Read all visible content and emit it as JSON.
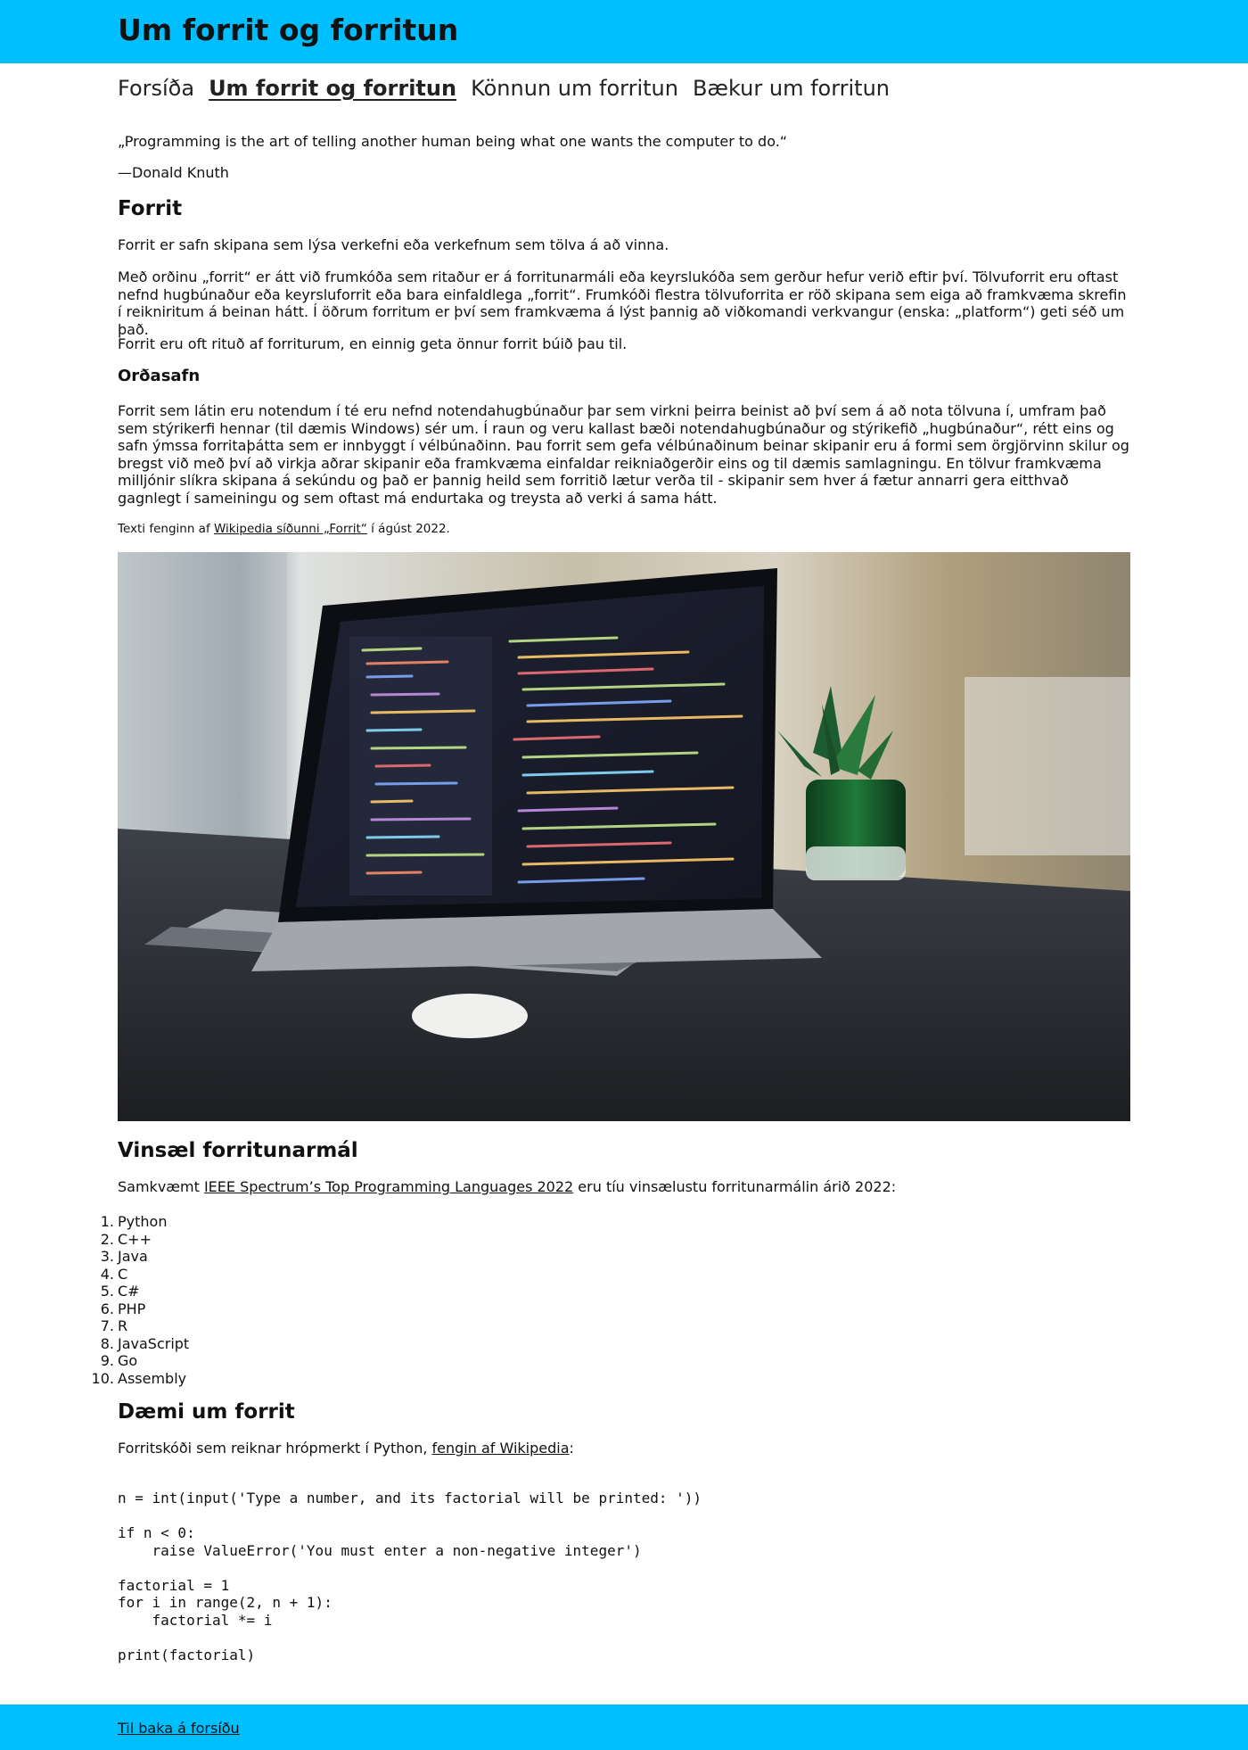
{
  "header": {
    "title": "Um forrit og forritun"
  },
  "nav": {
    "items": [
      {
        "label": "Forsíða",
        "active": false
      },
      {
        "label": "Um forrit og forritun",
        "active": true
      },
      {
        "label": "Könnun um forritun",
        "active": false
      },
      {
        "label": "Bækur um forritun",
        "active": false
      }
    ]
  },
  "quote": {
    "text": "„Programming is the art of telling another human being what one wants the computer to do.“",
    "author": "—Donald Knuth"
  },
  "section_forrit": {
    "heading": "Forrit",
    "p1": "Forrit er safn skipana sem lýsa verkefni eða verkefnum sem tölva á að vinna.",
    "p2": "Með orðinu „forrit“ er átt við frumkóða sem ritaður er á forritunarmáli eða keyrslukóða sem gerður hefur verið eftir því. Tölvuforrit eru oftast nefnd hugbúnaður eða keyrsluforrit eða bara einfaldlega „forrit“. Frumkóði flestra tölvuforrita er röð skipana sem eiga að framkvæma skrefin í reikniritum á beinan hátt. Í öðrum forritum er því sem framkvæma á lýst þannig að viðkomandi verkvangur (enska: „platform“) geti séð um það.",
    "p3": "Forrit eru oft rituð af forriturum, en einnig geta önnur forrit búið þau til."
  },
  "section_ordasafn": {
    "heading": "Orðasafn",
    "p1": "Forrit sem látin eru notendum í té eru nefnd notendahugbúnaður þar sem virkni þeirra beinist að því sem á að nota tölvuna í, umfram það sem stýrikerfi hennar (til dæmis Windows) sér um. Í raun og veru kallast bæði notendahugbúnaður og stýrikefið „hugbúnaður“, rétt eins og safn ýmssa forritaþátta sem er innbyggt í vélbúnaðinn. Þau forrit sem gefa vélbúnaðinum beinar skipanir eru á formi sem örgjörvinn skilur og bregst við með því að virkja aðrar skipanir eða framkvæma einfaldar reikniaðgerðir eins og til dæmis samlagningu. En tölvur framkvæma milljónir slíkra skipana á sekúndu og það er þannig heild sem forritið lætur verða til - skipanir sem hver á fætur annarri gera eitthvað gagnlegt í sameiningu og sem oftast má endurtaka og treysta að verki á sama hátt."
  },
  "attribution": {
    "prefix": "Texti fenginn af ",
    "link_text": "Wikipedia síðunni „Forrit“",
    "suffix": " í ágúst 2022."
  },
  "hero_image": {
    "alt": "laptop with code and a plant"
  },
  "section_langs": {
    "heading": "Vinsæl forritunarmál",
    "intro_prefix": "Samkvæmt ",
    "intro_link": "IEEE Spectrum’s Top Programming Languages 2022",
    "intro_suffix": " eru tíu vinsælustu forritunarmálin árið 2022:",
    "items": [
      "Python",
      "C++",
      "Java",
      "C",
      "C#",
      "PHP",
      "R",
      "JavaScript",
      "Go",
      "Assembly"
    ],
    "numbers": [
      "1.",
      "2.",
      "3.",
      "4.",
      "5.",
      "6.",
      "7.",
      "8.",
      "9.",
      "10."
    ]
  },
  "section_example": {
    "heading": "Dæmi um forrit",
    "intro_prefix": "Forritskóði sem reiknar hrópmerkt í Python, ",
    "intro_link": "fengin af Wikipedia",
    "intro_suffix": ":",
    "code": "n = int(input('Type a number, and its factorial will be printed: '))\n\nif n < 0:\n    raise ValueError('You must enter a non-negative integer')\n\nfactorial = 1\nfor i in range(2, n + 1):\n    factorial *= i\n\nprint(factorial)"
  },
  "footer": {
    "link": "Til baka á forsíðu"
  },
  "colors": {
    "accent": "#00bfff"
  }
}
